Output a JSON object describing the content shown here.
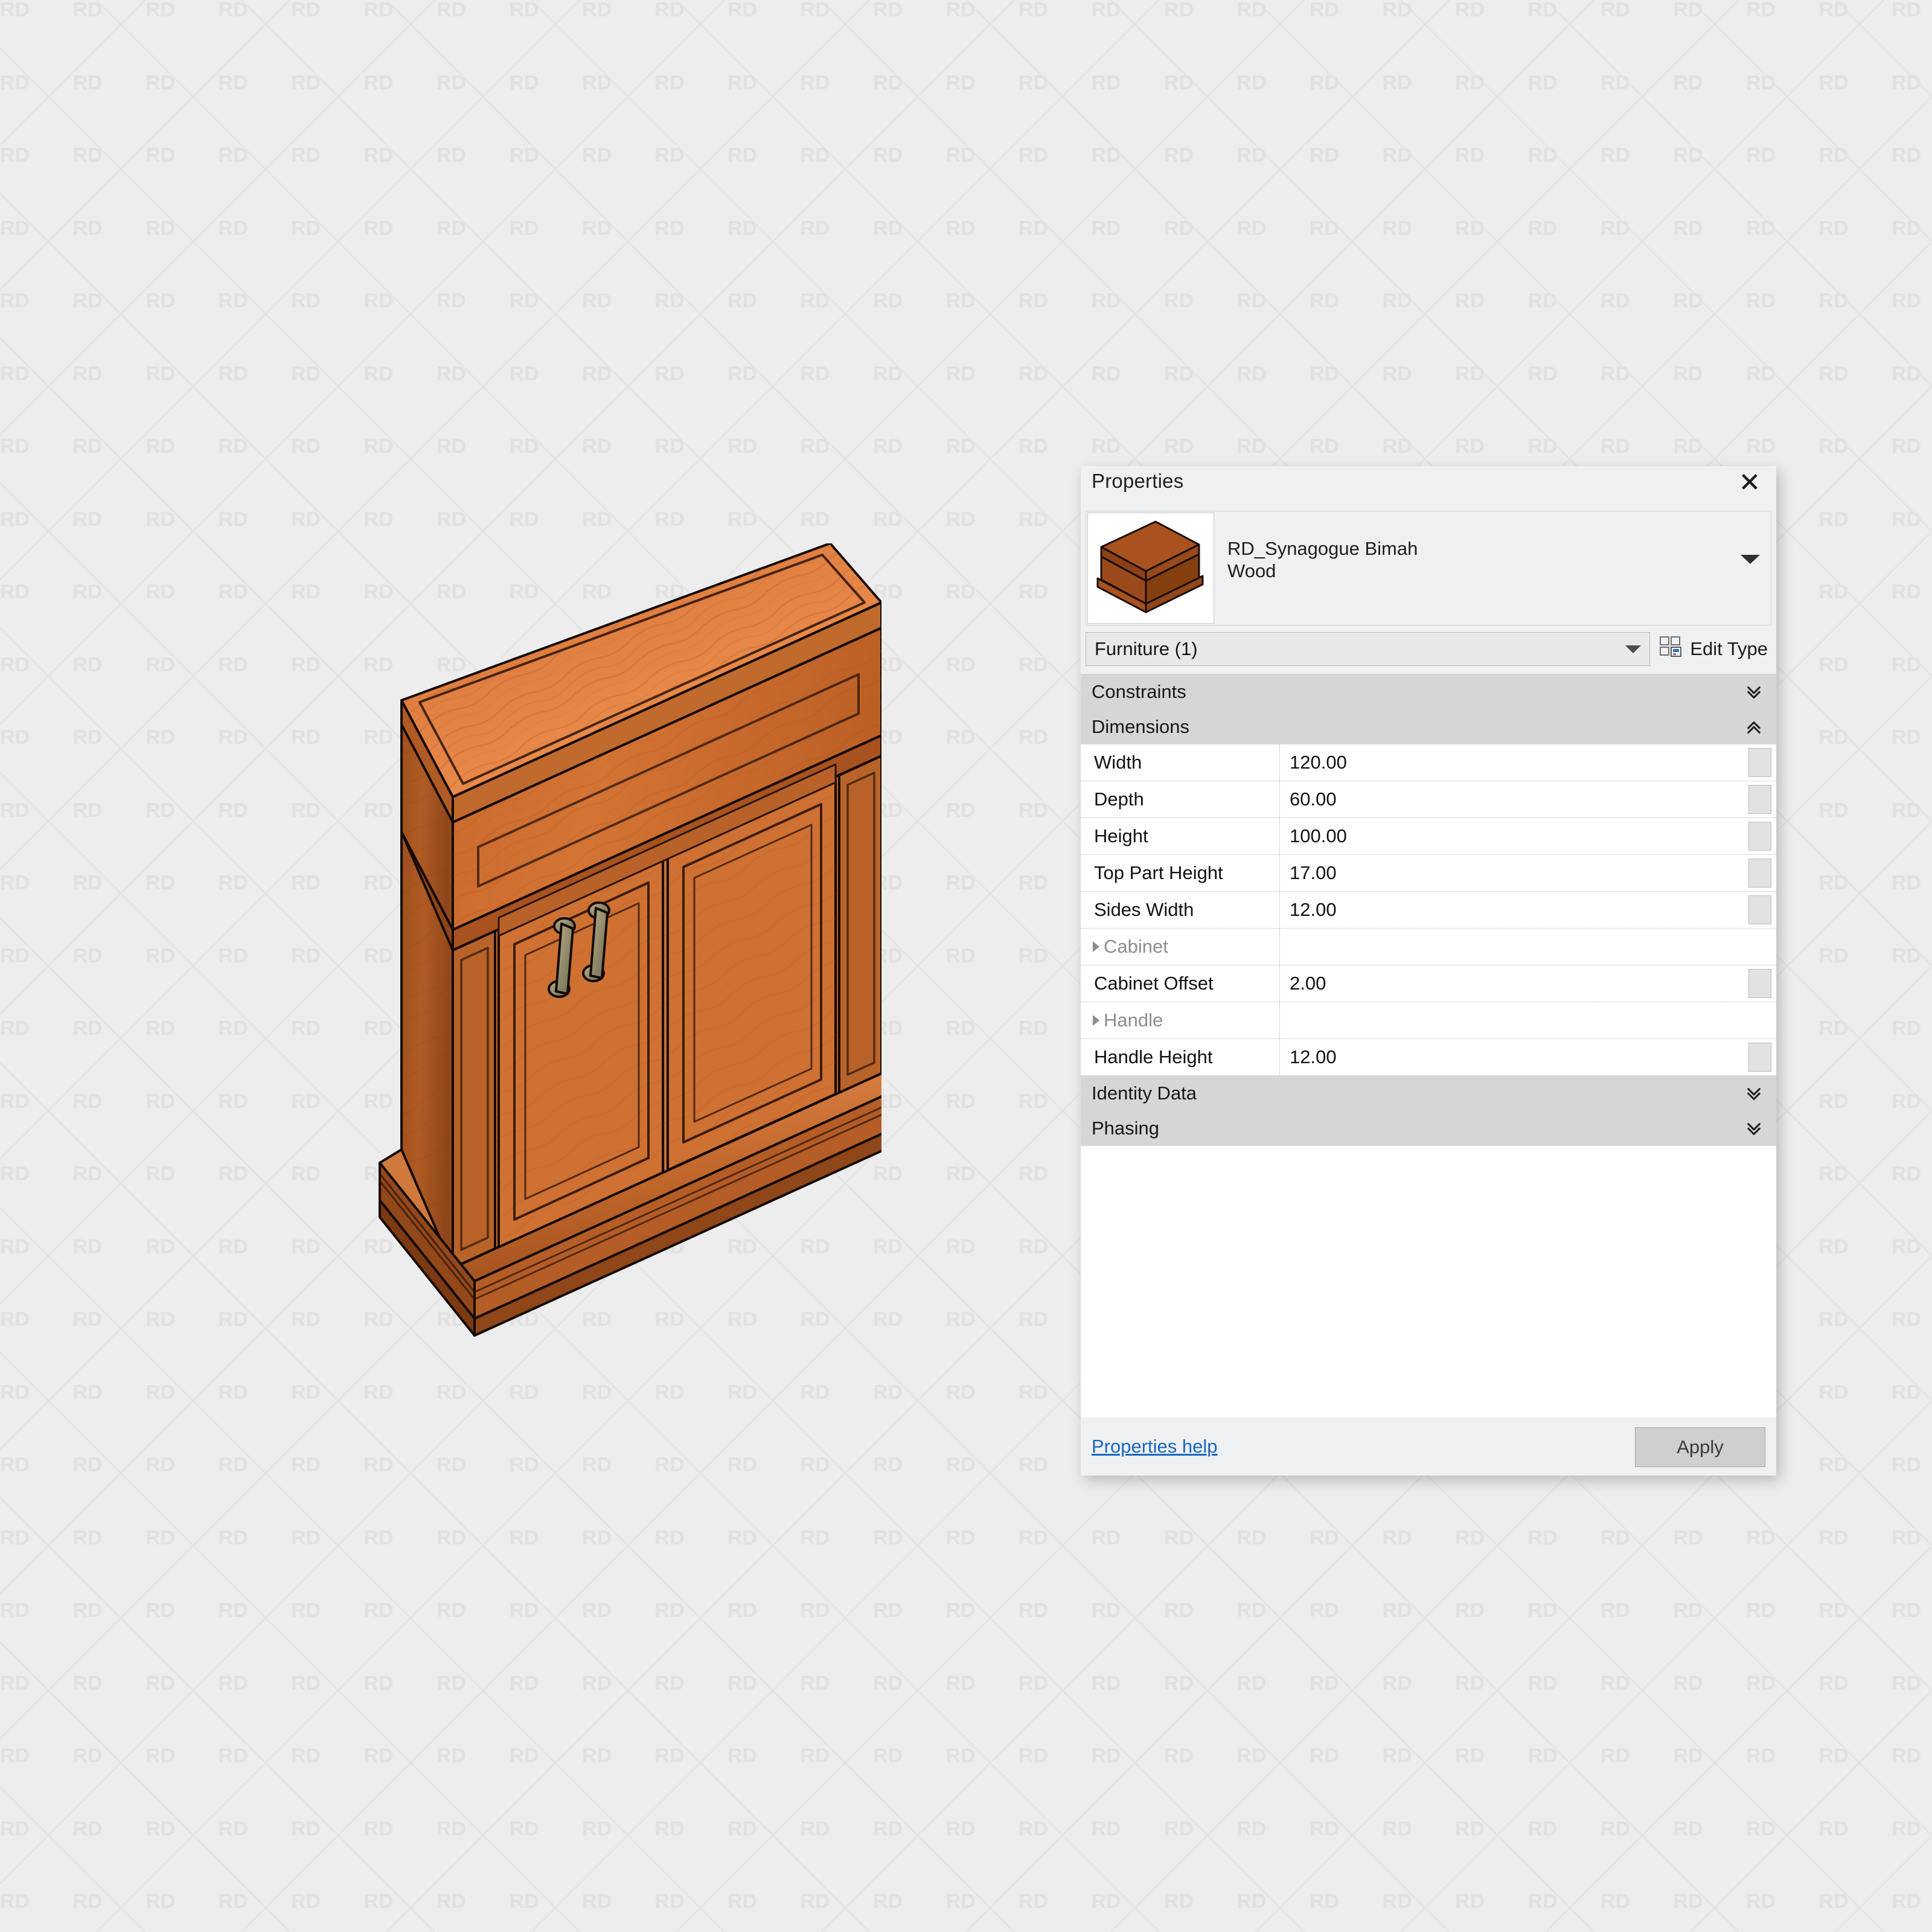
{
  "background": {
    "watermark_text": "RD",
    "bg_color": "#ededed",
    "watermark_color": "#e1e1e1"
  },
  "model": {
    "name": "RD_Synagogue Bimah",
    "description": "3D isometric rendering of a wooden synagogue bimah / lectern cabinet with sloped reading top, two paneled doors with brass handles and a molded plinth base",
    "wood_color": "#c0662a",
    "wood_top_color": "#e0803c",
    "wood_dark_color": "#9a4a18",
    "handle_color": "#a09a78"
  },
  "palette": {
    "title": "Properties",
    "close_icon": "close-icon",
    "thumbnail_alt": "furniture-thumbnail",
    "family_name": "RD_Synagogue Bimah",
    "type_name": "Wood",
    "type_selector_value": "Furniture (1)",
    "edit_type_label": "Edit Type",
    "edit_type_icon": "edit-type-icon",
    "help_label": "Properties help",
    "apply_label": "Apply",
    "groups": [
      {
        "label": "Constraints",
        "state": "collapsed",
        "chevron": "chevron-double-down-icon"
      },
      {
        "label": "Dimensions",
        "state": "expanded",
        "chevron": "chevron-double-up-icon"
      }
    ],
    "rows": [
      {
        "label": "Width",
        "value": "120.00",
        "kind": "param",
        "has_button": true
      },
      {
        "label": "Depth",
        "value": "60.00",
        "kind": "param",
        "has_button": true
      },
      {
        "label": "Height",
        "value": "100.00",
        "kind": "param",
        "has_button": true
      },
      {
        "label": "Top Part Height",
        "value": "17.00",
        "kind": "param",
        "has_button": true
      },
      {
        "label": "Sides Width",
        "value": "12.00",
        "kind": "param",
        "has_button": true
      },
      {
        "label": "Cabinet",
        "value": "",
        "kind": "subheader",
        "has_button": false
      },
      {
        "label": "Cabinet Offset",
        "value": "2.00",
        "kind": "param",
        "has_button": true
      },
      {
        "label": "Handle",
        "value": "",
        "kind": "subheader",
        "has_button": false
      },
      {
        "label": "Handle Height",
        "value": "12.00",
        "kind": "param",
        "has_button": true
      }
    ],
    "tail_groups": [
      {
        "label": "Identity Data",
        "state": "collapsed",
        "chevron": "chevron-double-down-icon"
      },
      {
        "label": "Phasing",
        "state": "collapsed",
        "chevron": "chevron-double-down-icon"
      }
    ]
  }
}
